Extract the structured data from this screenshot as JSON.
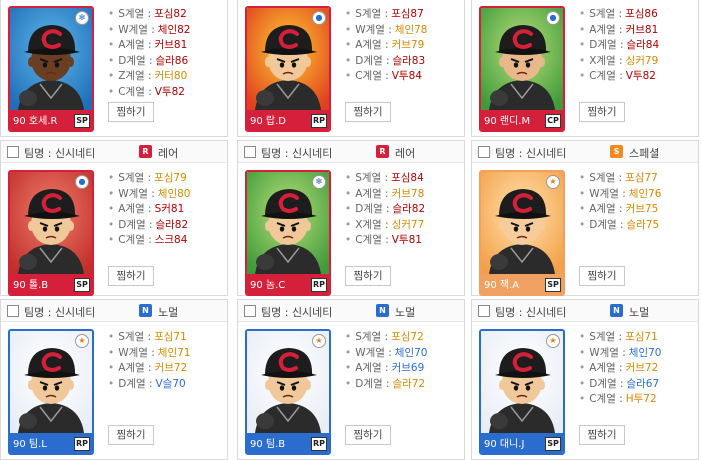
{
  "cells": [
    {
      "team": "",
      "grade": "",
      "grade_type": "none",
      "card_name": "90 호세.R",
      "position": "SP",
      "nameplate_color": "#d4203a",
      "card_border": "#d4203a",
      "corner_icon": "snowflake-icon",
      "bg": "blue",
      "skin": "#6a3e22",
      "wish": "찜하기",
      "skills": [
        {
          "label": "S계열 :",
          "value": "포심82",
          "color": "#b00000"
        },
        {
          "label": "W계열 :",
          "value": "체인82",
          "color": "#b00000"
        },
        {
          "label": "A계열 :",
          "value": "커브81",
          "color": "#b00000"
        },
        {
          "label": "D계열 :",
          "value": "슬라86",
          "color": "#b00000"
        },
        {
          "label": "Z계열 :",
          "value": "커터80",
          "color": "#d48a00"
        },
        {
          "label": "C계열 :",
          "value": "V투82",
          "color": "#b00000"
        }
      ]
    },
    {
      "team": "",
      "grade": "",
      "grade_type": "none",
      "card_name": "90 랍.D",
      "position": "RP",
      "nameplate_color": "#d4203a",
      "card_border": "#d4203a",
      "corner_icon": "ball-icon",
      "bg": "fire",
      "skin": "#f0c89a",
      "wish": "찜하기",
      "skills": [
        {
          "label": "S계열 :",
          "value": "포심87",
          "color": "#b00000"
        },
        {
          "label": "W계열 :",
          "value": "체인78",
          "color": "#d48a00"
        },
        {
          "label": "A계열 :",
          "value": "커브79",
          "color": "#d48a00"
        },
        {
          "label": "D계열 :",
          "value": "슬라83",
          "color": "#b00000"
        },
        {
          "label": "C계열 :",
          "value": "V투84",
          "color": "#b00000"
        }
      ]
    },
    {
      "team": "",
      "grade": "",
      "grade_type": "none",
      "card_name": "90 랜디.M",
      "position": "CP",
      "nameplate_color": "#d4203a",
      "card_border": "#d4203a",
      "corner_icon": "ball-icon",
      "bg": "green",
      "skin": "#e8b88a",
      "wish": "찜하기",
      "skills": [
        {
          "label": "S계열 :",
          "value": "포심86",
          "color": "#b00000"
        },
        {
          "label": "A계열 :",
          "value": "커브81",
          "color": "#b00000"
        },
        {
          "label": "D계열 :",
          "value": "슬라84",
          "color": "#b00000"
        },
        {
          "label": "X계열 :",
          "value": "싱커79",
          "color": "#d48a00"
        },
        {
          "label": "C계열 :",
          "value": "V투82",
          "color": "#b00000"
        }
      ]
    },
    {
      "team": "팀명 : 신시네티",
      "grade": "레어",
      "grade_type": "R",
      "card_name": "90 톨.B",
      "position": "SP",
      "nameplate_color": "#d4203a",
      "card_border": "#d4203a",
      "corner_icon": "ball-icon",
      "bg": "red",
      "skin": "#f0c89a",
      "wish": "찜하기",
      "skills": [
        {
          "label": "S계열 :",
          "value": "포심79",
          "color": "#d48a00"
        },
        {
          "label": "W계열 :",
          "value": "체인80",
          "color": "#d48a00"
        },
        {
          "label": "A계열 :",
          "value": "S커81",
          "color": "#b00000"
        },
        {
          "label": "D계열 :",
          "value": "슬라82",
          "color": "#b00000"
        },
        {
          "label": "C계열 :",
          "value": "스크84",
          "color": "#b00000"
        }
      ]
    },
    {
      "team": "팀명 : 신시네티",
      "grade": "레어",
      "grade_type": "R",
      "card_name": "90 놈.C",
      "position": "RP",
      "nameplate_color": "#d4203a",
      "card_border": "#d4203a",
      "corner_icon": "snowflake-icon",
      "bg": "green",
      "skin": "#f0c89a",
      "wish": "찜하기",
      "skills": [
        {
          "label": "S계열 :",
          "value": "포심84",
          "color": "#b00000"
        },
        {
          "label": "A계열 :",
          "value": "커브78",
          "color": "#d48a00"
        },
        {
          "label": "D계열 :",
          "value": "슬라82",
          "color": "#b00000"
        },
        {
          "label": "X계열 :",
          "value": "싱커77",
          "color": "#d48a00"
        },
        {
          "label": "C계열 :",
          "value": "V투81",
          "color": "#b00000"
        }
      ]
    },
    {
      "team": "팀명 : 신시네티",
      "grade": "스페셜",
      "grade_type": "S",
      "card_name": "90 잭.A",
      "position": "SP",
      "nameplate_color": "#f0a060",
      "card_border": "#f0a060",
      "corner_icon": "star-icon",
      "bg": "orange",
      "skin": "#f6cc9a",
      "wish": "찜하기",
      "skills": [
        {
          "label": "S계열 :",
          "value": "포심77",
          "color": "#d48a00"
        },
        {
          "label": "W계열 :",
          "value": "체인76",
          "color": "#d48a00"
        },
        {
          "label": "A계열 :",
          "value": "커브75",
          "color": "#d48a00"
        },
        {
          "label": "D계열 :",
          "value": "슬라75",
          "color": "#d48a00"
        }
      ]
    },
    {
      "team": "팀명 : 신시네티",
      "grade": "노멀",
      "grade_type": "N",
      "card_name": "90 팀.L",
      "position": "RP",
      "nameplate_color": "#2a6dcf",
      "card_border": "#2a6dcf",
      "corner_icon": "star-icon",
      "bg": "white",
      "skin": "#f0c89a",
      "wish": "찜하기",
      "skills": [
        {
          "label": "S계열 :",
          "value": "포심71",
          "color": "#d48a00"
        },
        {
          "label": "W계열 :",
          "value": "체인71",
          "color": "#d48a00"
        },
        {
          "label": "A계열 :",
          "value": "커브72",
          "color": "#d48a00"
        },
        {
          "label": "D계열 :",
          "value": "V슬70",
          "color": "#2a6dcf"
        }
      ]
    },
    {
      "team": "팀명 : 신시네티",
      "grade": "노멀",
      "grade_type": "N",
      "card_name": "90 팀.B",
      "position": "RP",
      "nameplate_color": "#2a6dcf",
      "card_border": "#2a6dcf",
      "corner_icon": "star-icon",
      "bg": "white",
      "skin": "#f0c89a",
      "wish": "찜하기",
      "skills": [
        {
          "label": "S계열 :",
          "value": "포심72",
          "color": "#d48a00"
        },
        {
          "label": "W계열 :",
          "value": "체인70",
          "color": "#2a6dcf"
        },
        {
          "label": "A계열 :",
          "value": "커브69",
          "color": "#2a6dcf"
        },
        {
          "label": "D계열 :",
          "value": "슬라72",
          "color": "#d48a00"
        }
      ]
    },
    {
      "team": "팀명 : 신시네티",
      "grade": "노멀",
      "grade_type": "N",
      "card_name": "90 대니.J",
      "position": "SP",
      "nameplate_color": "#2a6dcf",
      "card_border": "#2a6dcf",
      "corner_icon": "star-icon",
      "bg": "white",
      "skin": "#f0c89a",
      "wish": "찜하기",
      "skills": [
        {
          "label": "S계열 :",
          "value": "포심71",
          "color": "#d48a00"
        },
        {
          "label": "W계열 :",
          "value": "체인70",
          "color": "#2a6dcf"
        },
        {
          "label": "A계열 :",
          "value": "커브72",
          "color": "#d48a00"
        },
        {
          "label": "D계열 :",
          "value": "슬라67",
          "color": "#2a6dcf"
        },
        {
          "label": "C계열 :",
          "value": "H투72",
          "color": "#d48a00"
        }
      ]
    }
  ],
  "grade_colors": {
    "R": "#d4203a",
    "S": "#f08a1e",
    "N": "#2a6dcf"
  },
  "grade_letters": {
    "R": "R",
    "S": "S",
    "N": "N"
  }
}
